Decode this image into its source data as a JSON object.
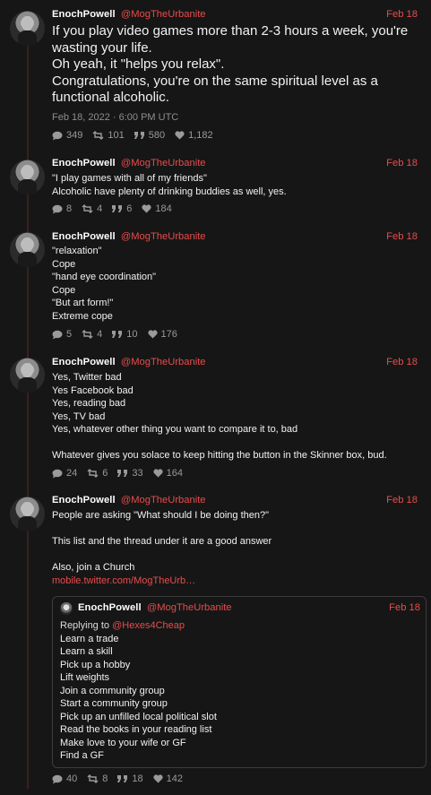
{
  "author": "EnochPowell",
  "handle": "@MogTheUrbanite",
  "colors": {
    "accent": "#e74c4c",
    "background": "#161616",
    "muted": "#9a9a9a"
  },
  "tweets": [
    {
      "date": "Feb 18",
      "lines": [
        "If you play video games more than 2-3 hours a week, you're wasting your life.",
        "Oh yeah, it \"helps you relax\".",
        "Congratulations, you're on the same spiritual level as a functional alcoholic."
      ],
      "timestamp": "Feb 18, 2022 · 6:00 PM UTC",
      "stats": {
        "replies": "349",
        "retweets": "101",
        "quotes": "580",
        "likes": "1,182"
      }
    },
    {
      "date": "Feb 18",
      "lines": [
        "\"I play games with all of my friends\"",
        "Alcoholic have plenty of drinking buddies as well, yes."
      ],
      "stats": {
        "replies": "8",
        "retweets": "4",
        "quotes": "6",
        "likes": "184"
      }
    },
    {
      "date": "Feb 18",
      "lines": [
        "\"relaxation\"",
        "Cope",
        "\"hand eye coordination\"",
        "Cope",
        "\"But art form!\"",
        "Extreme cope"
      ],
      "stats": {
        "replies": "5",
        "retweets": "4",
        "quotes": "10",
        "likes": "176"
      }
    },
    {
      "date": "Feb 18",
      "lines": [
        "Yes, Twitter bad",
        "Yes Facebook bad",
        "Yes, reading bad",
        "Yes, TV bad",
        "Yes, whatever other thing you want to compare it to, bad",
        "",
        "Whatever gives you solace to keep hitting the button in the Skinner box, bud."
      ],
      "stats": {
        "replies": "24",
        "retweets": "6",
        "quotes": "33",
        "likes": "164"
      }
    },
    {
      "date": "Feb 18",
      "lines": [
        "People are asking \"What should I be doing then?\"",
        "",
        "This list and the thread under it are a good answer",
        "",
        "Also, join a Church"
      ],
      "link": "mobile.twitter.com/MogTheUrb…",
      "stats": {
        "replies": "40",
        "retweets": "8",
        "quotes": "18",
        "likes": "142"
      }
    }
  ],
  "quote": {
    "author": "EnochPowell",
    "handle": "@MogTheUrbanite",
    "date": "Feb 18",
    "replying_to_label": "Replying to",
    "replying_to_handle": "@Hexes4Cheap",
    "lines": [
      "Learn a trade",
      "Learn a skill",
      "Pick up a hobby",
      "Lift weights",
      "Join a community group",
      "Start a community group",
      "Pick up an unfilled local political slot",
      "Read the books in your reading list",
      "Make love to your wife or GF",
      "Find a GF"
    ]
  }
}
